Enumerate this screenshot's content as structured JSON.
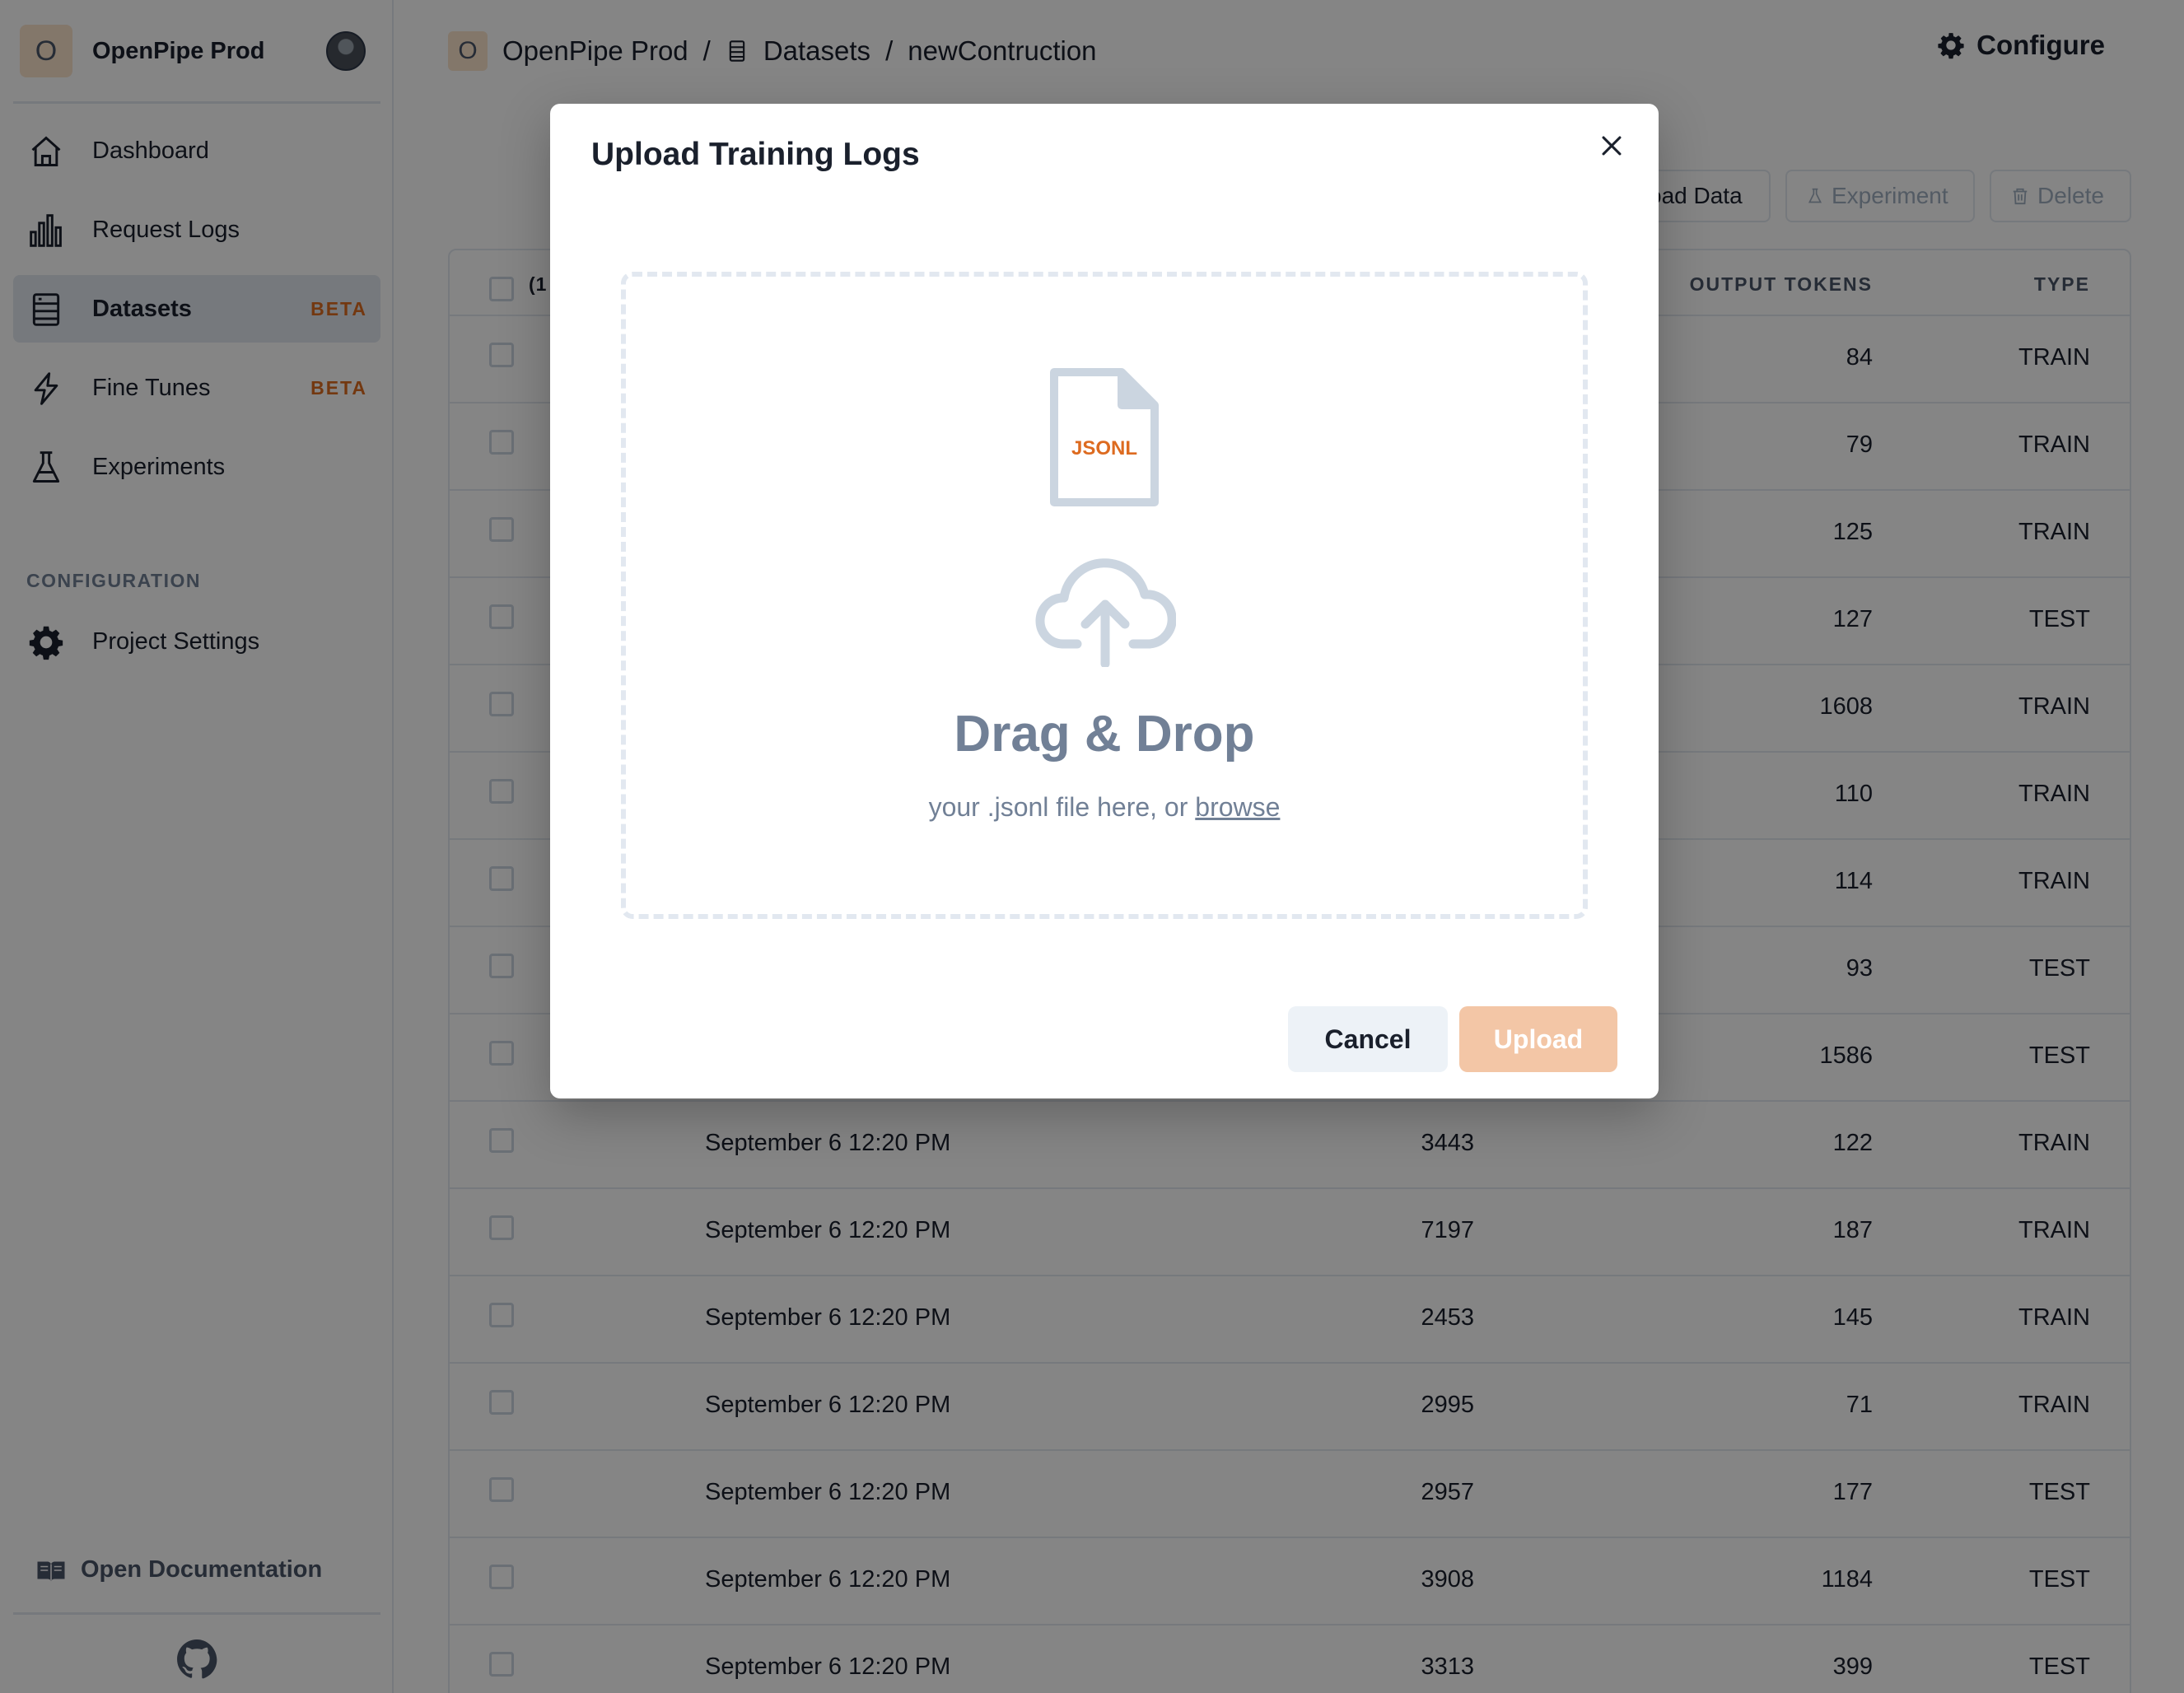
{
  "sidebar": {
    "project_initial": "O",
    "project_name": "OpenPipe Prod",
    "nav": [
      {
        "label": "Dashboard",
        "badge": ""
      },
      {
        "label": "Request Logs",
        "badge": ""
      },
      {
        "label": "Datasets",
        "badge": "BETA"
      },
      {
        "label": "Fine Tunes",
        "badge": "BETA"
      },
      {
        "label": "Experiments",
        "badge": ""
      }
    ],
    "section_label": "CONFIGURATION",
    "settings_label": "Project Settings",
    "docs_label": "Open Documentation"
  },
  "topbar": {
    "crumb_initial": "O",
    "crumb_project": "OpenPipe Prod",
    "crumb_sep": "/",
    "crumb_datasets": "Datasets",
    "crumb_dataset_name": "newContruction",
    "configure_label": "Configure"
  },
  "actions": {
    "upload_partial": "oad Data",
    "experiment": "Experiment",
    "delete": "Delete"
  },
  "table": {
    "header_select_partial": "(1",
    "headers": {
      "output_tokens": "OUTPUT TOKENS",
      "type": "TYPE"
    },
    "rows": [
      {
        "date": "",
        "input": "",
        "output": "84",
        "type": "TRAIN"
      },
      {
        "date": "",
        "input": "",
        "output": "79",
        "type": "TRAIN"
      },
      {
        "date": "",
        "input": "",
        "output": "125",
        "type": "TRAIN"
      },
      {
        "date": "",
        "input": "",
        "output": "127",
        "type": "TEST"
      },
      {
        "date": "",
        "input": "",
        "output": "1608",
        "type": "TRAIN"
      },
      {
        "date": "",
        "input": "",
        "output": "110",
        "type": "TRAIN"
      },
      {
        "date": "",
        "input": "",
        "output": "114",
        "type": "TRAIN"
      },
      {
        "date": "",
        "input": "",
        "output": "93",
        "type": "TEST"
      },
      {
        "date": "",
        "input": "",
        "output": "1586",
        "type": "TEST"
      },
      {
        "date": "September 6 12:20 PM",
        "input": "3443",
        "output": "122",
        "type": "TRAIN"
      },
      {
        "date": "September 6 12:20 PM",
        "input": "7197",
        "output": "187",
        "type": "TRAIN"
      },
      {
        "date": "September 6 12:20 PM",
        "input": "2453",
        "output": "145",
        "type": "TRAIN"
      },
      {
        "date": "September 6 12:20 PM",
        "input": "2995",
        "output": "71",
        "type": "TRAIN"
      },
      {
        "date": "September 6 12:20 PM",
        "input": "2957",
        "output": "177",
        "type": "TEST"
      },
      {
        "date": "September 6 12:20 PM",
        "input": "3908",
        "output": "1184",
        "type": "TEST"
      },
      {
        "date": "September 6 12:20 PM",
        "input": "3313",
        "output": "399",
        "type": "TEST"
      }
    ]
  },
  "modal": {
    "title": "Upload Training Logs",
    "file_badge": "JSONL",
    "dz_title": "Drag & Drop",
    "dz_sub": "your .jsonl file here, or ",
    "dz_browse": "browse",
    "cancel": "Cancel",
    "upload": "Upload"
  },
  "colors": {
    "accent": "#dd6b20",
    "upload_disabled": "#f3c6a6",
    "overlay": "rgba(0,0,0,0.48)"
  }
}
